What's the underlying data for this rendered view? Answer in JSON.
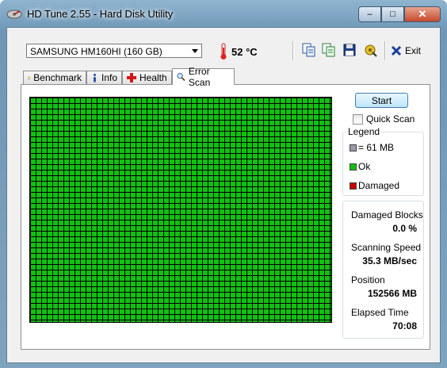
{
  "window": {
    "title": "HD Tune 2.55 - Hard Disk Utility",
    "controls": {
      "minimize": "–",
      "maximize": "□",
      "close": "✕"
    }
  },
  "toolbar": {
    "drive": "SAMSUNG HM160HI (160 GB)",
    "temperature": "52 °C",
    "exit_label": "Exit",
    "icons": [
      "copy-text-icon",
      "copy-info-icon",
      "save-icon",
      "options-icon",
      "exit-x-icon"
    ]
  },
  "tabs": [
    {
      "label": "Benchmark",
      "icon": "bulb-icon"
    },
    {
      "label": "Info",
      "icon": "info-icon"
    },
    {
      "label": "Health",
      "icon": "health-cross-icon"
    },
    {
      "label": "Error Scan",
      "icon": "magnifier-icon",
      "active": true
    }
  ],
  "scan": {
    "start_label": "Start",
    "quick_scan_label": "Quick Scan",
    "quick_scan_checked": false,
    "block_colors": {
      "ok": "#11c111",
      "damaged": "#cc0000",
      "unscanned": "#8c8c8c"
    }
  },
  "legend": {
    "title": "Legend",
    "items": [
      {
        "label": "= 61 MB",
        "color": "#9a9aa8"
      },
      {
        "label": "Ok",
        "color": "#11c111"
      },
      {
        "label": "Damaged",
        "color": "#cc0000"
      }
    ]
  },
  "stats": {
    "damaged_blocks_label": "Damaged Blocks",
    "damaged_blocks_value": "0.0 %",
    "scanning_speed_label": "Scanning Speed",
    "scanning_speed_value": "35.3 MB/sec",
    "position_label": "Position",
    "position_value": "152566 MB",
    "elapsed_label": "Elapsed Time",
    "elapsed_value": "70:08"
  }
}
